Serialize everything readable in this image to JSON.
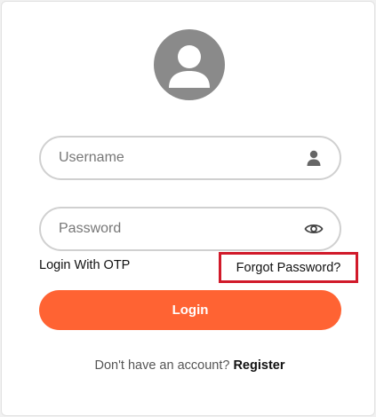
{
  "colors": {
    "accent": "#ff6333",
    "avatar_bg": "#8a8a8a",
    "highlight_border": "#d11a2a"
  },
  "avatar": {
    "icon": "user-avatar-icon"
  },
  "username": {
    "placeholder": "Username",
    "value": "",
    "icon": "person-icon"
  },
  "password": {
    "placeholder": "Password",
    "value": "",
    "icon": "eye-icon"
  },
  "links": {
    "otp": "Login With OTP",
    "forgot": "Forgot Password?"
  },
  "login_button": "Login",
  "footer": {
    "prompt": "Don't have an account?",
    "register": "Register"
  }
}
